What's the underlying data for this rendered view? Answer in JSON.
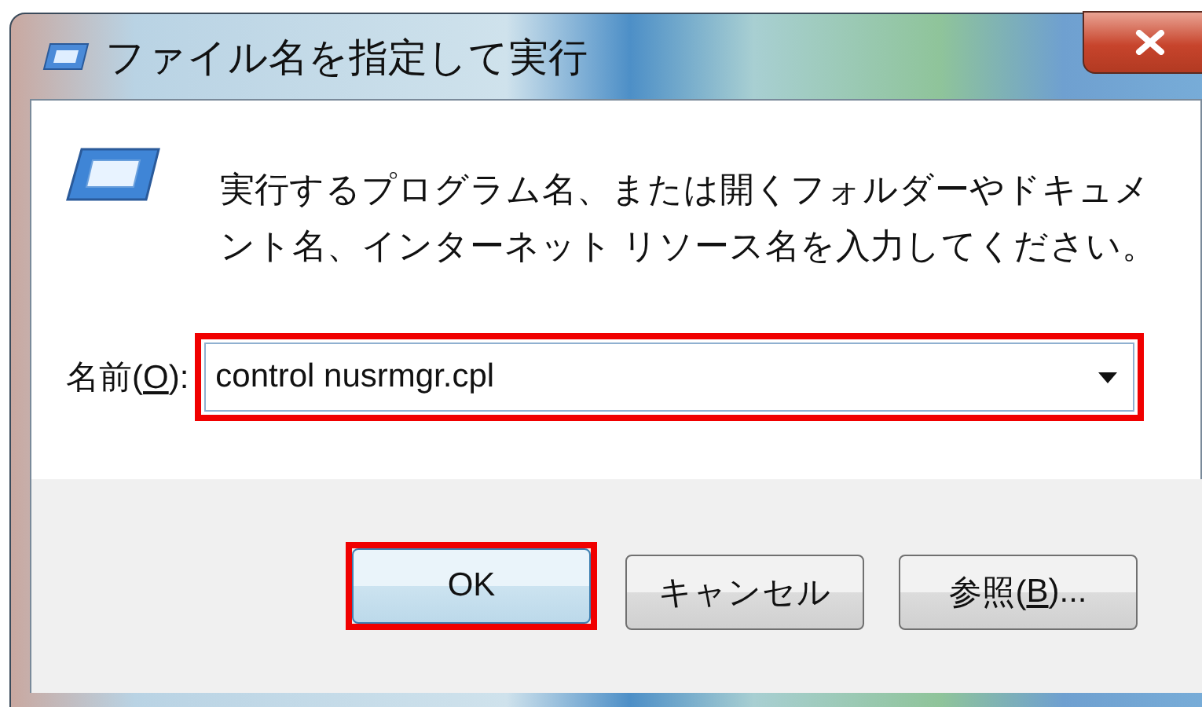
{
  "window": {
    "title": "ファイル名を指定して実行"
  },
  "description_lines": [
    "実行するプログラム名、または開くフォルダーやドキュメ",
    "ント名、インターネット リソース名を入力してください。"
  ],
  "name_field": {
    "label": {
      "before": "名前(",
      "key": "O",
      "after": "):"
    },
    "value": "control nusrmgr.cpl",
    "highlighted": true
  },
  "buttons": [
    {
      "label": {
        "before": "OK"
      },
      "default": true,
      "highlighted": true
    },
    {
      "label": {
        "before": "キャンセル"
      },
      "default": false,
      "highlighted": false
    },
    {
      "label": {
        "before": "参照(",
        "key": "B",
        "after": ")..."
      },
      "default": false,
      "highlighted": false
    }
  ]
}
